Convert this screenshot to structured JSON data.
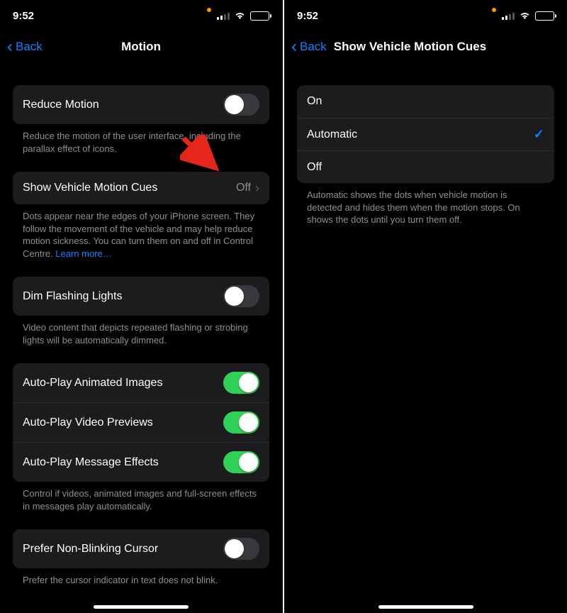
{
  "status": {
    "time": "9:52"
  },
  "left": {
    "back": "Back",
    "title": "Motion",
    "groups": {
      "reduceMotion": {
        "label": "Reduce Motion",
        "footer": "Reduce the motion of the user interface, including the parallax effect of icons."
      },
      "vehicleCues": {
        "label": "Show Vehicle Motion Cues",
        "value": "Off",
        "footer": "Dots appear near the edges of your iPhone screen. They follow the movement of the vehicle and may help reduce motion sickness. You can turn them on and off in Control Centre. ",
        "learnMore": "Learn more…"
      },
      "dim": {
        "label": "Dim Flashing Lights",
        "footer": "Video content that depicts repeated flashing or strobing lights will be automatically dimmed."
      },
      "autoplay": {
        "images": "Auto-Play Animated Images",
        "video": "Auto-Play Video Previews",
        "effects": "Auto-Play Message Effects",
        "footer": "Control if videos, animated images and full-screen effects in messages play automatically."
      },
      "cursor": {
        "label": "Prefer Non-Blinking Cursor",
        "footer": "Prefer the cursor indicator in text does not blink."
      }
    }
  },
  "right": {
    "back": "Back",
    "title": "Show Vehicle Motion Cues",
    "options": {
      "on": "On",
      "auto": "Automatic",
      "off": "Off"
    },
    "footer": "Automatic shows the dots when vehicle motion is detected and hides them when the motion stops. On shows the dots until you turn them off."
  }
}
